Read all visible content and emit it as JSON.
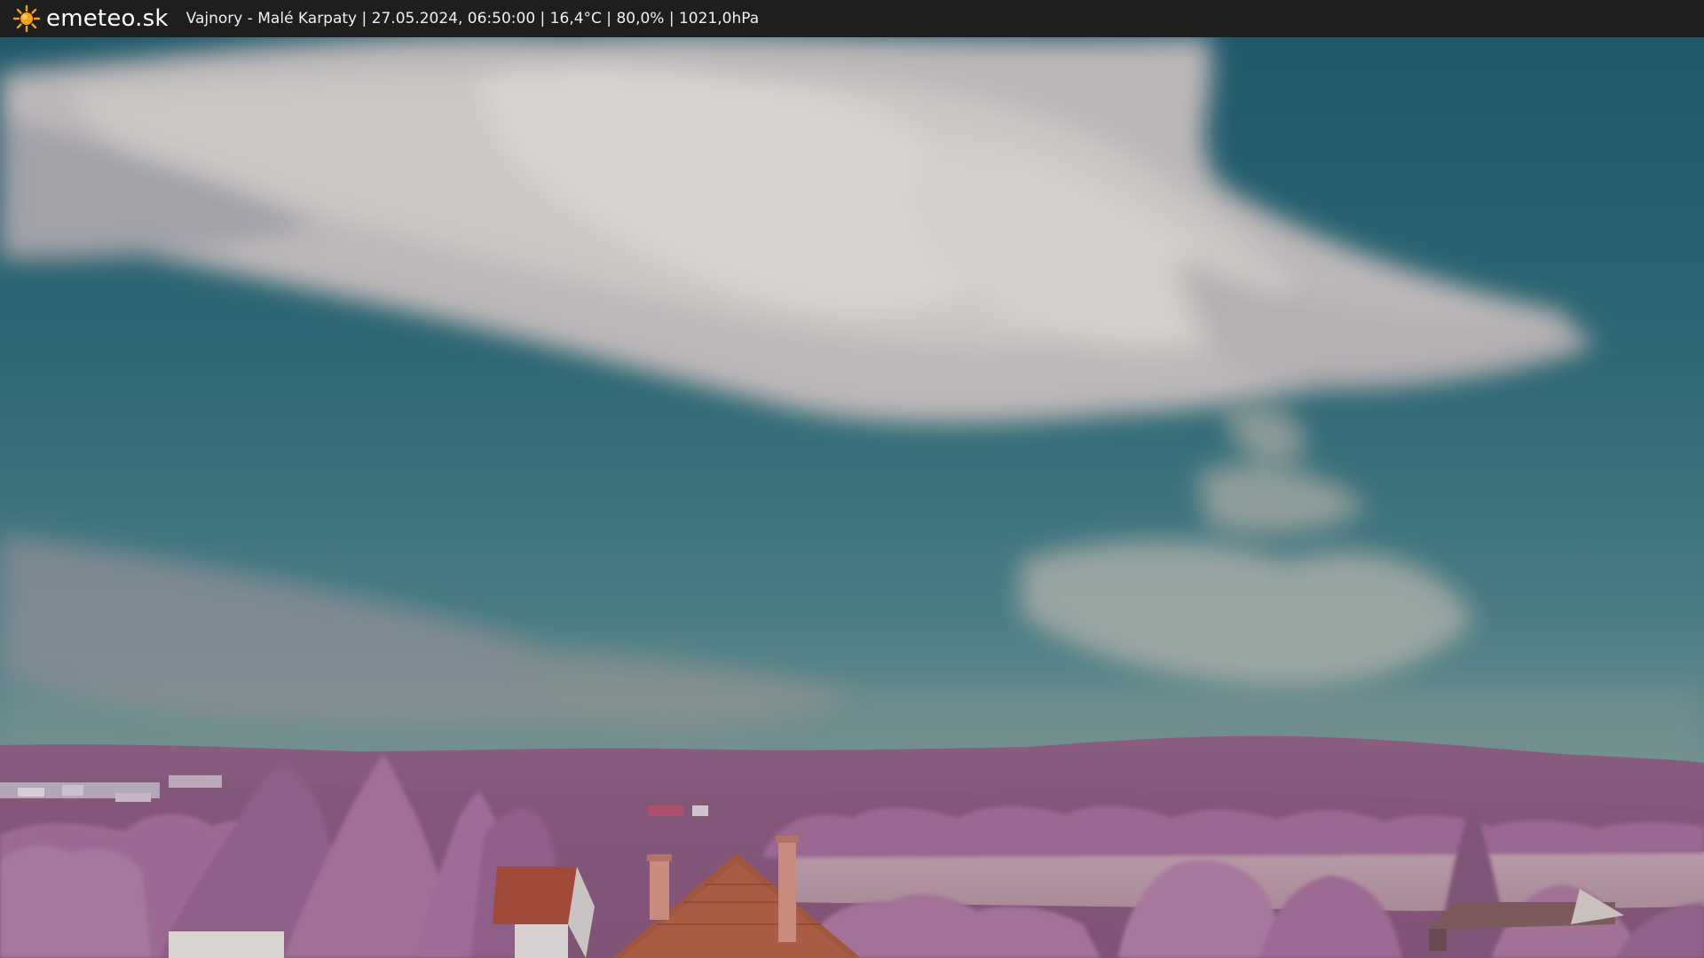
{
  "header": {
    "brand": "emeteo.sk",
    "brand_icon": "sun-icon",
    "caption": "Vajnory - Malé Karpaty | 27.05.2024, 06:50:00 | 16,4°C | 80,0% | 1021,0hPa"
  },
  "colors": {
    "bar": "#1e1e1e",
    "sun": "#f7a21b",
    "sky_top": "#27606f",
    "sky_bottom": "#5f8a8f",
    "cloud": "#cfc6c4",
    "foliage": "#9d6c95",
    "roof": "#a0563f"
  }
}
